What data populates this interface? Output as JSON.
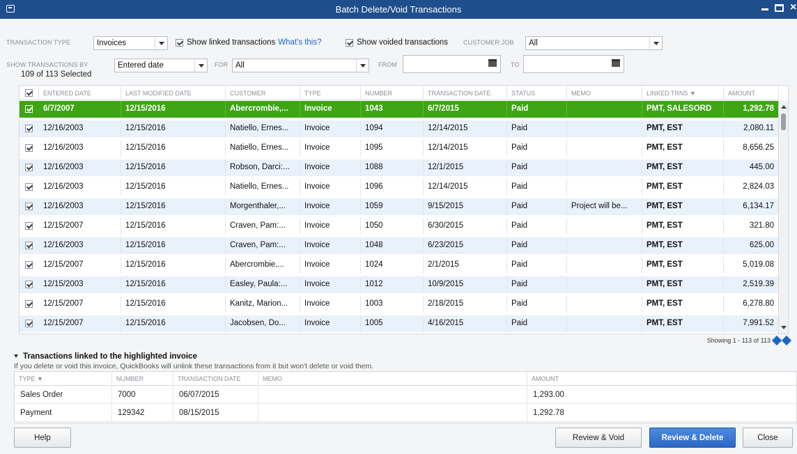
{
  "window": {
    "title": "Batch Delete/Void Transactions"
  },
  "filters": {
    "transaction_type_label": "TRANSACTION TYPE",
    "transaction_type_value": "Invoices",
    "show_linked_label": "Show linked transactions",
    "whats_this": "What's this?",
    "show_voided_label": "Show voided transactions",
    "customer_job_label": "CUSTOMER:JOB",
    "customer_job_value": "All",
    "show_by_label": "SHOW TRANSACTIONS BY",
    "show_by_value": "Entered date",
    "for_label": "FOR",
    "for_value": "All",
    "from_label": "FROM",
    "from_value": "",
    "to_label": "TO",
    "to_value": ""
  },
  "selection_count": "109 of 113 Selected",
  "grid": {
    "headers": [
      "ENTERED DATE",
      "LAST MODIFIED DATE",
      "CUSTOMER",
      "TYPE",
      "NUMBER",
      "TRANSACTION DATE",
      "STATUS",
      "MEMO",
      "LINKED TRNS ▼",
      "AMOUNT"
    ],
    "rows": [
      {
        "entered": "6/7/2007",
        "modified": "12/15/2016",
        "customer": "Abercrombie,...",
        "type": "Invoice",
        "number": "1043",
        "txn_date": "6/7/2015",
        "status": "Paid",
        "memo": "",
        "linked": "PMT, SALESORD",
        "amount": "1,292.78"
      },
      {
        "entered": "12/16/2003",
        "modified": "12/15/2016",
        "customer": "Natiello, Ernes...",
        "type": "Invoice",
        "number": "1094",
        "txn_date": "12/14/2015",
        "status": "Paid",
        "memo": "",
        "linked": "PMT, EST",
        "amount": "2,080.11"
      },
      {
        "entered": "12/16/2003",
        "modified": "12/15/2016",
        "customer": "Natiello, Ernes...",
        "type": "Invoice",
        "number": "1095",
        "txn_date": "12/14/2015",
        "status": "Paid",
        "memo": "",
        "linked": "PMT, EST",
        "amount": "8,656.25"
      },
      {
        "entered": "12/16/2003",
        "modified": "12/15/2016",
        "customer": "Robson, Darci:...",
        "type": "Invoice",
        "number": "1088",
        "txn_date": "12/1/2015",
        "status": "Paid",
        "memo": "",
        "linked": "PMT, EST",
        "amount": "445.00"
      },
      {
        "entered": "12/16/2003",
        "modified": "12/15/2016",
        "customer": "Natiello, Ernes...",
        "type": "Invoice",
        "number": "1096",
        "txn_date": "12/14/2015",
        "status": "Paid",
        "memo": "",
        "linked": "PMT, EST",
        "amount": "2,824.03"
      },
      {
        "entered": "12/16/2003",
        "modified": "12/15/2016",
        "customer": "Morgenthaler,...",
        "type": "Invoice",
        "number": "1059",
        "txn_date": "9/15/2015",
        "status": "Paid",
        "memo": "Project will be...",
        "linked": "PMT, EST",
        "amount": "6,134.17"
      },
      {
        "entered": "12/15/2007",
        "modified": "12/15/2016",
        "customer": "Craven, Pam:...",
        "type": "Invoice",
        "number": "1050",
        "txn_date": "6/30/2015",
        "status": "Paid",
        "memo": "",
        "linked": "PMT, EST",
        "amount": "321.80"
      },
      {
        "entered": "12/16/2003",
        "modified": "12/15/2016",
        "customer": "Craven, Pam:...",
        "type": "Invoice",
        "number": "1048",
        "txn_date": "6/23/2015",
        "status": "Paid",
        "memo": "",
        "linked": "PMT, EST",
        "amount": "625.00"
      },
      {
        "entered": "12/15/2007",
        "modified": "12/15/2016",
        "customer": "Abercrombie,...",
        "type": "Invoice",
        "number": "1024",
        "txn_date": "2/1/2015",
        "status": "Paid",
        "memo": "",
        "linked": "PMT, EST",
        "amount": "5,019.08"
      },
      {
        "entered": "12/15/2003",
        "modified": "12/15/2016",
        "customer": "Easley, Paula:...",
        "type": "Invoice",
        "number": "1012",
        "txn_date": "10/9/2015",
        "status": "Paid",
        "memo": "",
        "linked": "PMT, EST",
        "amount": "2,519.39"
      },
      {
        "entered": "12/15/2007",
        "modified": "12/15/2016",
        "customer": "Kanitz, Marion...",
        "type": "Invoice",
        "number": "1003",
        "txn_date": "2/18/2015",
        "status": "Paid",
        "memo": "",
        "linked": "PMT, EST",
        "amount": "6,278.80"
      },
      {
        "entered": "12/15/2007",
        "modified": "12/15/2016",
        "customer": "Jacobsen, Do...",
        "type": "Invoice",
        "number": "1005",
        "txn_date": "4/16/2015",
        "status": "Paid",
        "memo": "",
        "linked": "PMT, EST",
        "amount": "7,991.52"
      }
    ]
  },
  "pager": {
    "text": "Showing 1 - 113 of 113"
  },
  "linked_section": {
    "title": "Transactions linked to the highlighted invoice",
    "note": "If you delete or void this invoice, QuickBooks will unlink these transactions from it but won't delete or void them.",
    "headers": [
      "TYPE ▼",
      "NUMBER",
      "TRANSACTION DATE",
      "MEMO",
      "AMOUNT"
    ],
    "rows": [
      {
        "type": "Sales Order",
        "number": "7000",
        "date": "06/07/2015",
        "memo": "",
        "amount": "1,293.00"
      },
      {
        "type": "Payment",
        "number": "129342",
        "date": "08/15/2015",
        "memo": "",
        "amount": "1,292.78"
      }
    ]
  },
  "buttons": {
    "help": "Help",
    "review_void": "Review & Void",
    "review_delete": "Review & Delete",
    "close": "Close"
  },
  "colors": {
    "title_bar": "#1f4e8c",
    "selected_row": "#3ea515",
    "alt_row": "#e9f1fa",
    "primary_button": "#2a67c4"
  }
}
